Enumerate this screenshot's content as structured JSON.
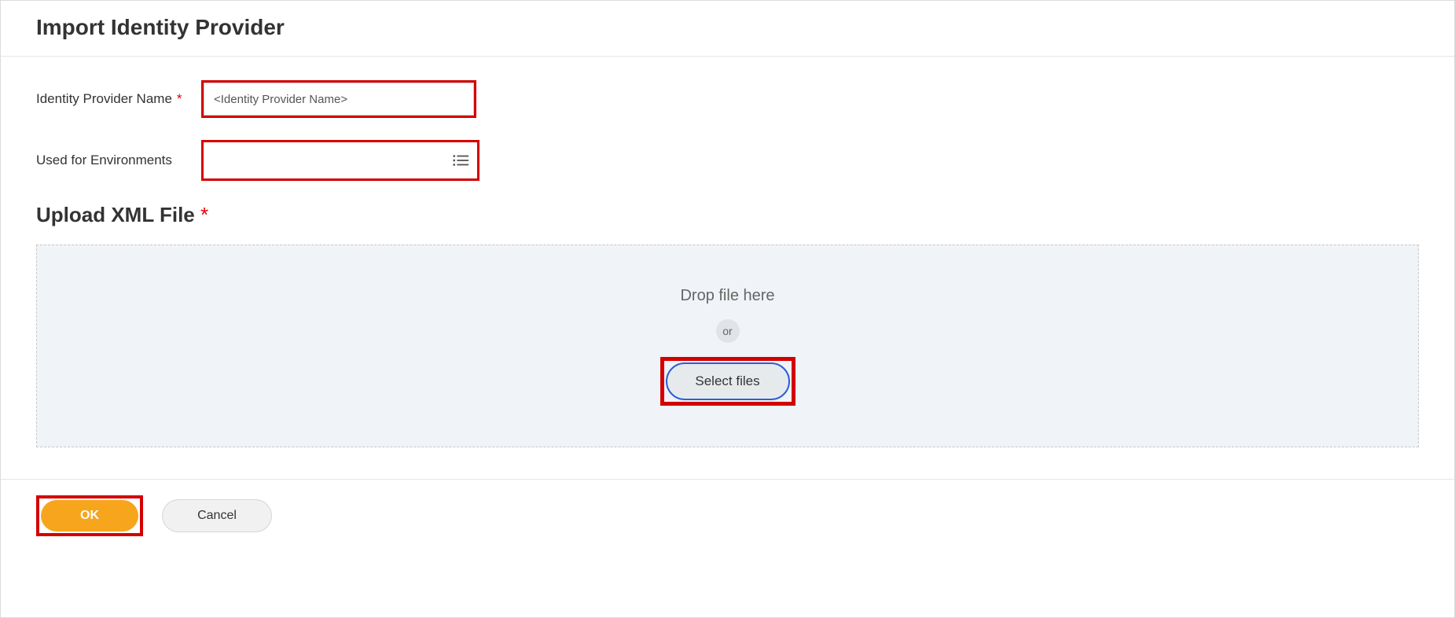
{
  "header": {
    "title": "Import Identity Provider"
  },
  "form": {
    "name_label": "Identity Provider Name",
    "name_value": "<Identity Provider Name>",
    "env_label": "Used for Environments",
    "env_value": ""
  },
  "upload": {
    "heading": "Upload XML File",
    "asterisk": "*",
    "drop_text": "Drop file here",
    "or_label": "or",
    "select_label": "Select files"
  },
  "footer": {
    "ok_label": "OK",
    "cancel_label": "Cancel"
  },
  "icons": {
    "list": "list-icon"
  }
}
